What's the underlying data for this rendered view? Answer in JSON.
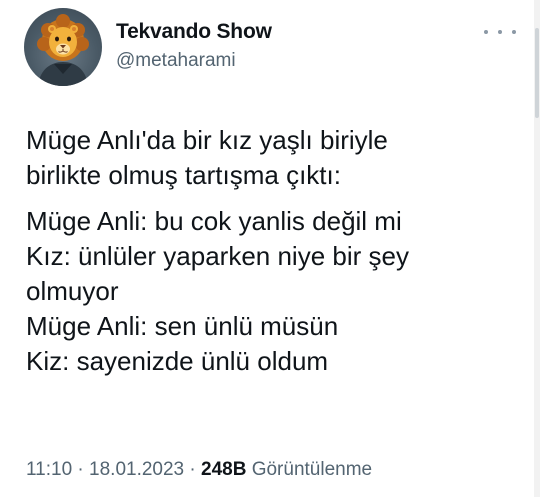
{
  "author": {
    "name": "Tekvando Show",
    "handle": "@metaharami",
    "avatar_icon": "lion-face-avatar"
  },
  "more_icon": "more-horizontal-icon",
  "tweet_text": {
    "paragraph_1": [
      "Müge Anlı'da bir kız yaşlı biriyle",
      "birlikte olmuş tartışma çıktı:"
    ],
    "paragraph_2": [
      "Müge Anli: bu cok yanlis değil mi",
      "Kız: ünlüler yaparken niye bir şey",
      "olmuyor",
      "Müge Anli: sen ünlü müsün",
      "Kiz: sayenizde ünlü oldum"
    ]
  },
  "meta": {
    "time": "11:10",
    "separator_1": " · ",
    "date": "18.01.2023",
    "separator_2": " · ",
    "views_count": "248B",
    "views_label": " Görüntülenme"
  },
  "colors": {
    "text": "#0f1419",
    "secondary": "#536471"
  }
}
